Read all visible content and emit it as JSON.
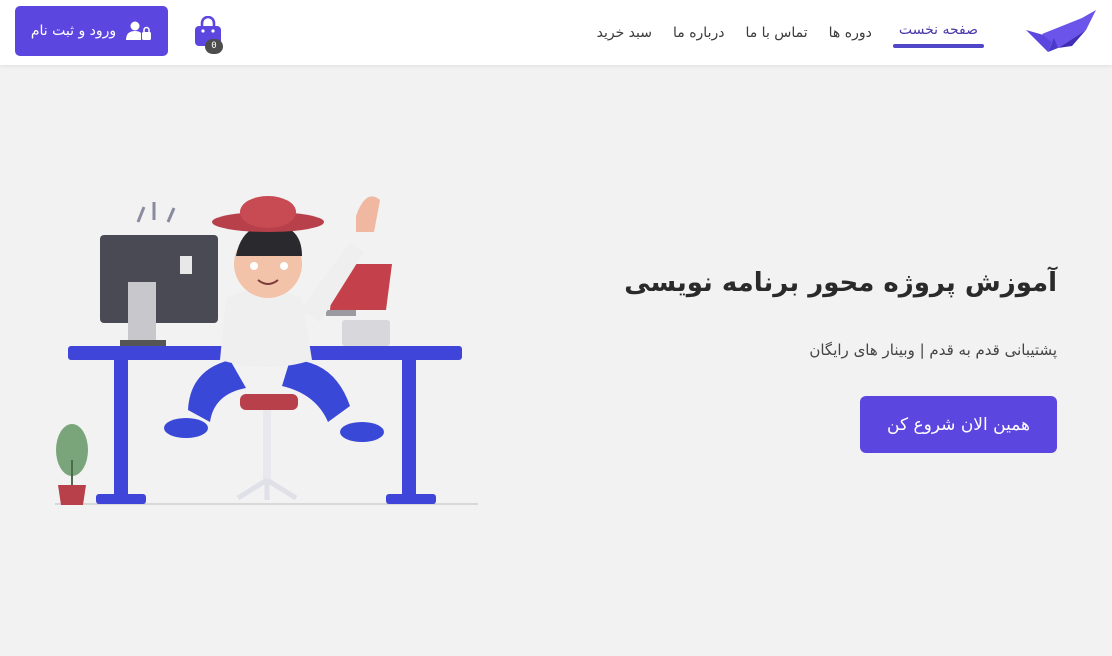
{
  "header": {
    "nav": [
      {
        "label": "صفحه نخست",
        "active": true
      },
      {
        "label": "دوره ها",
        "active": false
      },
      {
        "label": "تماس با ما",
        "active": false
      },
      {
        "label": "درباره ما",
        "active": false
      },
      {
        "label": "سبد خرید",
        "active": false
      }
    ],
    "cart_count": "0",
    "login_label": "ورود و ثبت نام"
  },
  "hero": {
    "title": "آموزش پروژه محور برنامه نویسی",
    "subtitle": "پشتیبانی قدم به قدم | وبینار های رایگان",
    "cta_label": "همین الان شروع کن"
  },
  "colors": {
    "accent": "#5c46e0",
    "nav_underline": "#5046c8",
    "background": "#f2f2f2",
    "header_bg": "#ffffff"
  },
  "icons": [
    "logo-bird-icon",
    "shopping-bag-icon",
    "user-lock-icon"
  ]
}
